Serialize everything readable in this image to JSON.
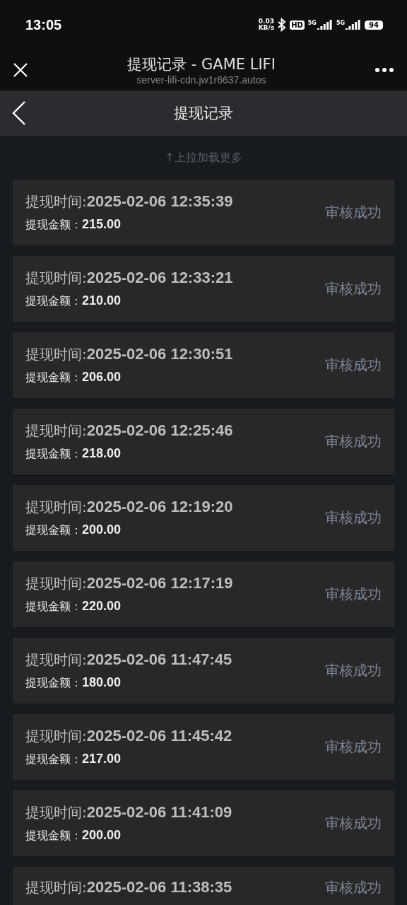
{
  "status_bar": {
    "time": "13:05",
    "speed_value": "0.03",
    "speed_unit": "KB/s",
    "hd": "HD",
    "sim1": "5G",
    "sim2": "5G",
    "battery": "94"
  },
  "browser": {
    "title": "提现记录 - GAME LIFI",
    "url": "server-lifi-cdn.jw1r6637.autos"
  },
  "nav": {
    "title": "提现记录"
  },
  "load_hint": "↑上拉加载更多",
  "records": [
    {
      "time_label": "提现时间:",
      "time": "2025-02-06 12:35:39",
      "amount_label": "提现金额：",
      "amount": "215.00",
      "status": "审核成功"
    },
    {
      "time_label": "提现时间:",
      "time": "2025-02-06 12:33:21",
      "amount_label": "提现金额：",
      "amount": "210.00",
      "status": "审核成功"
    },
    {
      "time_label": "提现时间:",
      "time": "2025-02-06 12:30:51",
      "amount_label": "提现金额：",
      "amount": "206.00",
      "status": "审核成功"
    },
    {
      "time_label": "提现时间:",
      "time": "2025-02-06 12:25:46",
      "amount_label": "提现金额：",
      "amount": "218.00",
      "status": "审核成功"
    },
    {
      "time_label": "提现时间:",
      "time": "2025-02-06 12:19:20",
      "amount_label": "提现金额：",
      "amount": "200.00",
      "status": "审核成功"
    },
    {
      "time_label": "提现时间:",
      "time": "2025-02-06 12:17:19",
      "amount_label": "提现金额：",
      "amount": "220.00",
      "status": "审核成功"
    },
    {
      "time_label": "提现时间:",
      "time": "2025-02-06 11:47:45",
      "amount_label": "提现金额：",
      "amount": "180.00",
      "status": "审核成功"
    },
    {
      "time_label": "提现时间:",
      "time": "2025-02-06 11:45:42",
      "amount_label": "提现金额：",
      "amount": "217.00",
      "status": "审核成功"
    },
    {
      "time_label": "提现时间:",
      "time": "2025-02-06 11:41:09",
      "amount_label": "提现金额：",
      "amount": "200.00",
      "status": "审核成功"
    },
    {
      "time_label": "提现时间:",
      "time": "2025-02-06 11:38:35",
      "status": "审核成功"
    }
  ]
}
